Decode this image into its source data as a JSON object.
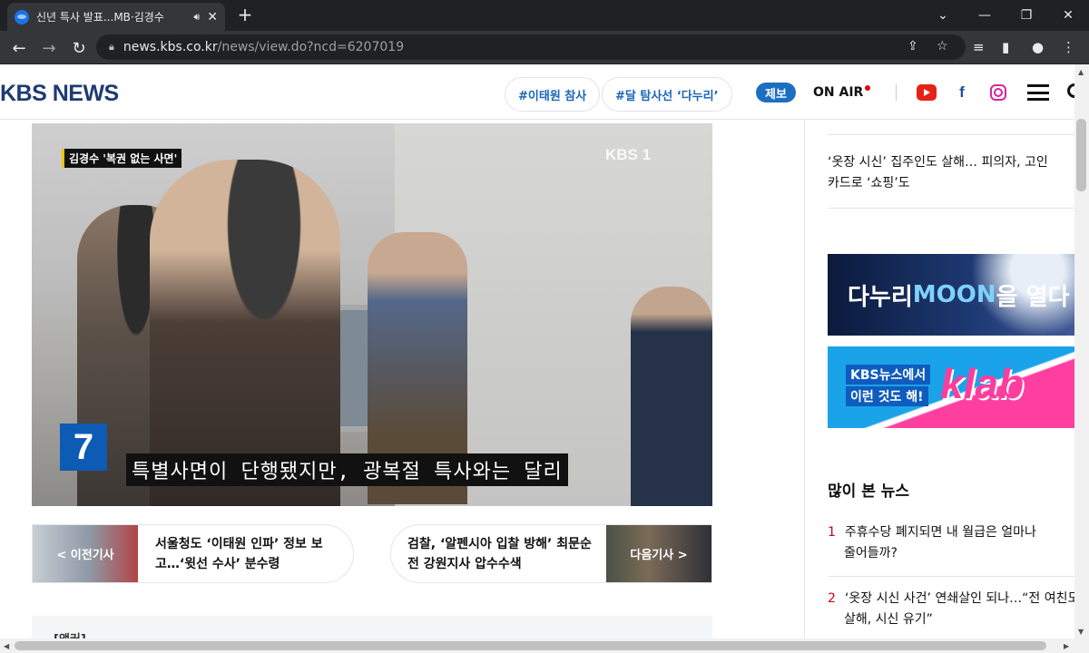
{
  "browser": {
    "tab_title": "신년 특사 발표...MB·김경수",
    "new_tab": "+",
    "url_host": "news.kbs.co.kr",
    "url_path": "/news/view.do?ncd=6207019"
  },
  "site": {
    "logo": "KBS NEWS",
    "hashtags": [
      "#이태원 참사",
      "#달 탐사선 ‘다누리’"
    ],
    "report_label": "제보",
    "onair_label": "ON AIR"
  },
  "video": {
    "top_caption": "김경수 '복권 없는 사면'",
    "channel_logo": "KBS 1",
    "channel_number": "7",
    "subtitle": "특별사면이 단행됐지만, 광복절 특사와는 달리"
  },
  "article_nav": {
    "prev_label": "< 이전기사",
    "prev_title": "서울청도 ‘이태원 인파’ 정보 보고…‘윗선 수사’ 분수령",
    "next_label": "다음기사 >",
    "next_title": "검찰, ‘알펜시아 입찰 방해’ 최문순 전 강원지사 압수수색",
    "anchor_label": "[앵커]"
  },
  "sidebar": {
    "top_news_line1": "‘옷장 시신’ 집주인도 살해… 피의자, 고인",
    "top_news_line2": "카드로 ‘쇼핑’도",
    "ad1_text_a": "다누리 ",
    "ad1_text_b": "MOON",
    "ad1_text_c": "을 열다",
    "ad2_line1": "KBS뉴스에서",
    "ad2_line2": "이런 것도 해!",
    "ad2_brand": "klab",
    "popular_heading": "많이 본 뉴스",
    "popular": [
      {
        "rank": "1",
        "line1": "주휴수당 폐지되면 내 월급은 얼마나",
        "line2": "줄어들까?"
      },
      {
        "rank": "2",
        "line1": "‘옷장 시신 사건’ 연쇄살인 되나…“전 여친도",
        "line2": "살해, 시신 유기”"
      }
    ]
  },
  "icons": {
    "accent": "#1b6fc0",
    "live_dot": "#e60012",
    "rank_color": "#d0021b"
  }
}
